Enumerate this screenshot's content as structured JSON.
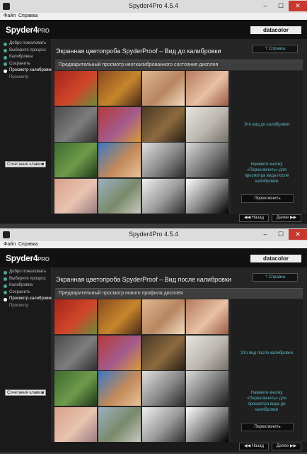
{
  "windows": [
    {
      "title": "Spyder4Pro 4.5.4",
      "menu": [
        "Файл",
        "Справка"
      ],
      "logo": {
        "main": "Spyder4",
        "suffix": "PRO"
      },
      "brand": "datacolor",
      "page_title": "Экранная цветопроба SpyderProof – Вид до калибровки",
      "help_label": "? Справка",
      "sub_header": "Предварительный просмотр неоткалиброванного состояния дисплея",
      "steps": [
        {
          "label": "Добро пожаловать",
          "state": "done"
        },
        {
          "label": "Выберите процесс",
          "state": "done"
        },
        {
          "label": "Калибровка",
          "state": "done"
        },
        {
          "label": "Сохранить",
          "state": "done"
        },
        {
          "label": "Просмотр калибровки",
          "state": "current"
        },
        {
          "label": "Просмотр",
          "state": "off"
        }
      ],
      "shortcuts": "Сочетания клавиш",
      "side_label": "Это вид до калибровки",
      "side_note": "Нажмите кнопку «Переключить» для просмотра вида после калибровки",
      "switch_button": "Переключить",
      "back_button": "◀◀ Назад",
      "next_button": "Далее ▶▶"
    },
    {
      "title": "Spyder4Pro 4.5.4",
      "menu": [
        "Файл",
        "Справка"
      ],
      "logo": {
        "main": "Spyder4",
        "suffix": "PRO"
      },
      "brand": "datacolor",
      "page_title": "Экранная цветопроба SpyderProof – Вид после калибровки",
      "help_label": "? Справка",
      "sub_header": "Предварительный просмотр нового профиля дисплея",
      "steps": [
        {
          "label": "Добро пожаловать",
          "state": "done"
        },
        {
          "label": "Выберите процесс",
          "state": "done"
        },
        {
          "label": "Калибровка",
          "state": "done"
        },
        {
          "label": "Сохранить",
          "state": "done"
        },
        {
          "label": "Просмотр калибровки",
          "state": "current"
        },
        {
          "label": "Просмотр",
          "state": "off"
        }
      ],
      "shortcuts": "Сочетания клавиш",
      "side_label": "Это вид после калибровки",
      "side_note": "Нажмите кнопку «Переключить» для просмотра вида до калибровки",
      "switch_button": "Переключить",
      "back_button": "◀◀ Назад",
      "next_button": "Далее ▶▶"
    }
  ],
  "photos": [
    {
      "name": "red-peppers-photo",
      "colors": [
        "#a3251b",
        "#d0462a",
        "#6b8a3a"
      ]
    },
    {
      "name": "spice-bowls-photo",
      "colors": [
        "#8a4a20",
        "#c6862d",
        "#4a2a18"
      ]
    },
    {
      "name": "blonde-woman-photo",
      "colors": [
        "#e0b890",
        "#b88660",
        "#f3dcc0"
      ]
    },
    {
      "name": "girl-portrait-photo",
      "colors": [
        "#b57a5b",
        "#e8c1a5",
        "#9a5a44"
      ]
    },
    {
      "name": "color-checker-photo",
      "colors": [
        "#4b4b4b",
        "#7d7d7d",
        "#2f2f2f"
      ]
    },
    {
      "name": "yarn-spools-photo",
      "colors": [
        "#b73a3a",
        "#a35b8c",
        "#d89a3a"
      ]
    },
    {
      "name": "violinist-photo",
      "colors": [
        "#4a3a26",
        "#8c6a3e",
        "#2a2016"
      ]
    },
    {
      "name": "bride-dress-photo",
      "colors": [
        "#e8e4df",
        "#bbb6b0",
        "#75706a"
      ]
    },
    {
      "name": "garden-topiary-photo",
      "colors": [
        "#3f6b32",
        "#6e9a4a",
        "#1e3818"
      ]
    },
    {
      "name": "adobe-church-photo",
      "colors": [
        "#3a78c4",
        "#c28a5a",
        "#e8c29a"
      ]
    },
    {
      "name": "bw-portrait-photo",
      "colors": [
        "#e0e0e0",
        "#888888",
        "#2a2a2a"
      ]
    },
    {
      "name": "spiral-staircase-photo",
      "colors": [
        "#dadada",
        "#777777",
        "#1d1d1d"
      ]
    },
    {
      "name": "sunset-sky-photo",
      "colors": [
        "#d8a08a",
        "#e8c4b0",
        "#9a7a80"
      ]
    },
    {
      "name": "mountain-valley-photo",
      "colors": [
        "#9ab0c0",
        "#7a8a6a",
        "#c8c8c0"
      ]
    },
    {
      "name": "bw-skull-photo",
      "colors": [
        "#f0f0f0",
        "#9a9a9a",
        "#303030"
      ]
    },
    {
      "name": "bw-gradient-photo",
      "colors": [
        "#ffffff",
        "#808080",
        "#000000"
      ]
    }
  ]
}
